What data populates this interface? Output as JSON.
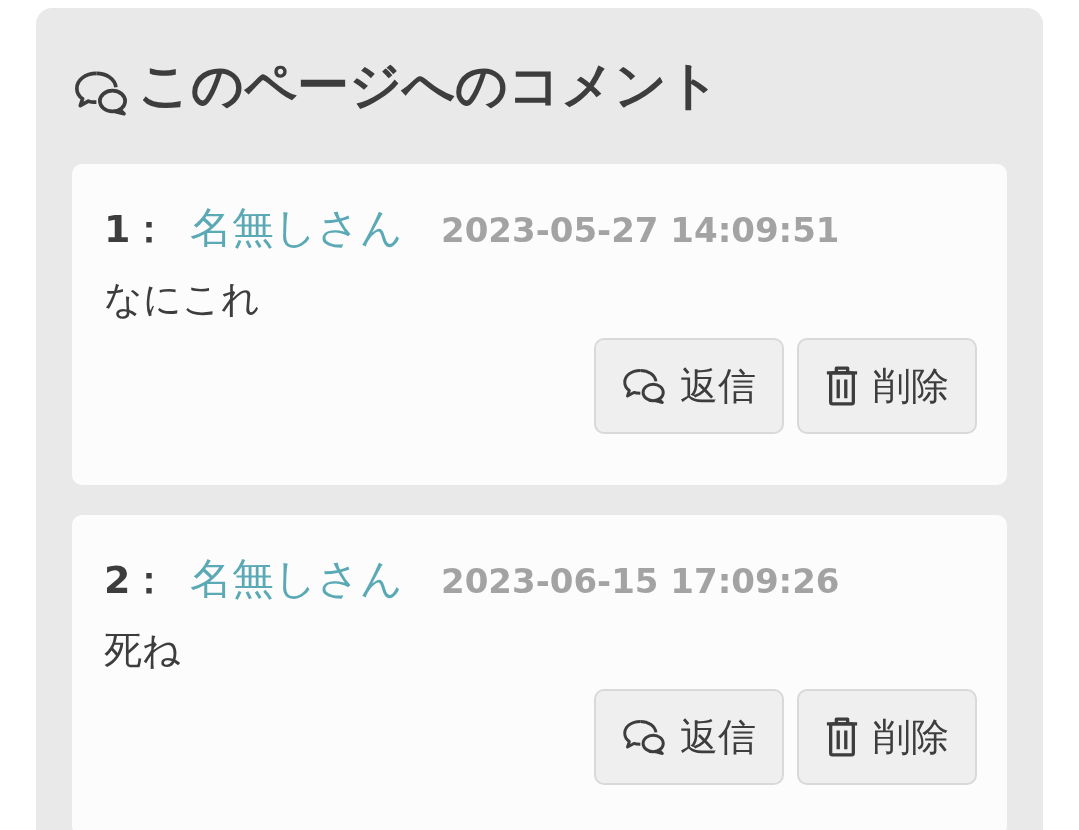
{
  "section": {
    "title": "このページへのコメント"
  },
  "comments": [
    {
      "number": "1：",
      "author": "名無しさん",
      "date": "2023-05-27 14:09:51",
      "body": "なにこれ",
      "buttons": [
        "返信",
        "削除"
      ]
    },
    {
      "number": "2：",
      "author": "名無しさん",
      "date": "2023-06-15 17:09:26",
      "body": "死ね",
      "buttons": [
        "返信",
        "削除"
      ]
    }
  ]
}
